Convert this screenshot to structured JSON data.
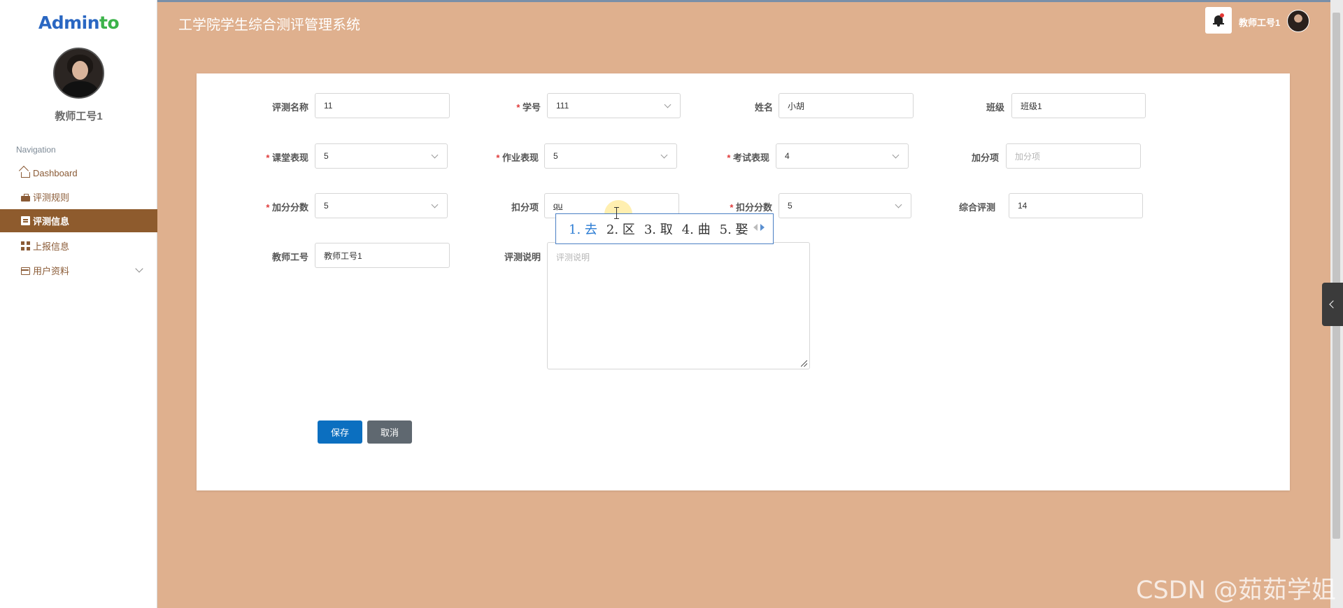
{
  "app": {
    "logo_main": "Admin",
    "logo_accent": "to",
    "title": "工学院学生综合测评管理系统"
  },
  "sidebar": {
    "user_name": "教师工号1",
    "nav_title": "Navigation",
    "items": [
      {
        "label": "Dashboard",
        "icon": "home-icon"
      },
      {
        "label": "评测规则",
        "icon": "briefcase-icon"
      },
      {
        "label": "评测信息",
        "icon": "document-icon",
        "active": true
      },
      {
        "label": "上报信息",
        "icon": "grid-icon"
      },
      {
        "label": "用户资料",
        "icon": "card-icon",
        "expandable": true
      }
    ]
  },
  "header": {
    "user_name": "教师工号1"
  },
  "form": {
    "pingce_name": {
      "label": "评测名称",
      "value": "11"
    },
    "xuehao": {
      "label": "学号",
      "value": "111"
    },
    "xingming": {
      "label": "姓名",
      "value": "小胡"
    },
    "banji": {
      "label": "班级",
      "value": "班级1"
    },
    "ketang": {
      "label": "课堂表现",
      "value": "5"
    },
    "zuoye": {
      "label": "作业表现",
      "value": "5"
    },
    "kaoshi": {
      "label": "考试表现",
      "value": "4"
    },
    "jiafenxiang": {
      "label": "加分项",
      "placeholder": "加分项"
    },
    "jiafenshu": {
      "label": "加分分数",
      "value": "5"
    },
    "koufenxiang": {
      "label": "扣分项",
      "value": "qu"
    },
    "koufenshu": {
      "label": "扣分分数",
      "value": "5"
    },
    "zonghe": {
      "label": "综合评测",
      "value": "14"
    },
    "jiaoshi": {
      "label": "教师工号",
      "value": "教师工号1"
    },
    "shuoming": {
      "label": "评测说明",
      "placeholder": "评测说明"
    },
    "save_label": "保存",
    "cancel_label": "取消"
  },
  "ime": {
    "candidates": [
      "1. 去",
      "2. 区",
      "3. 取",
      "4. 曲",
      "5. 娶"
    ]
  },
  "watermark": "CSDN @茹茹学姐",
  "colors": {
    "background": "#dfb08e",
    "active_nav": "#8e5b2d",
    "save_button": "#0b6fc0",
    "cancel_button": "#5f6870",
    "required": "#e03b3b"
  }
}
